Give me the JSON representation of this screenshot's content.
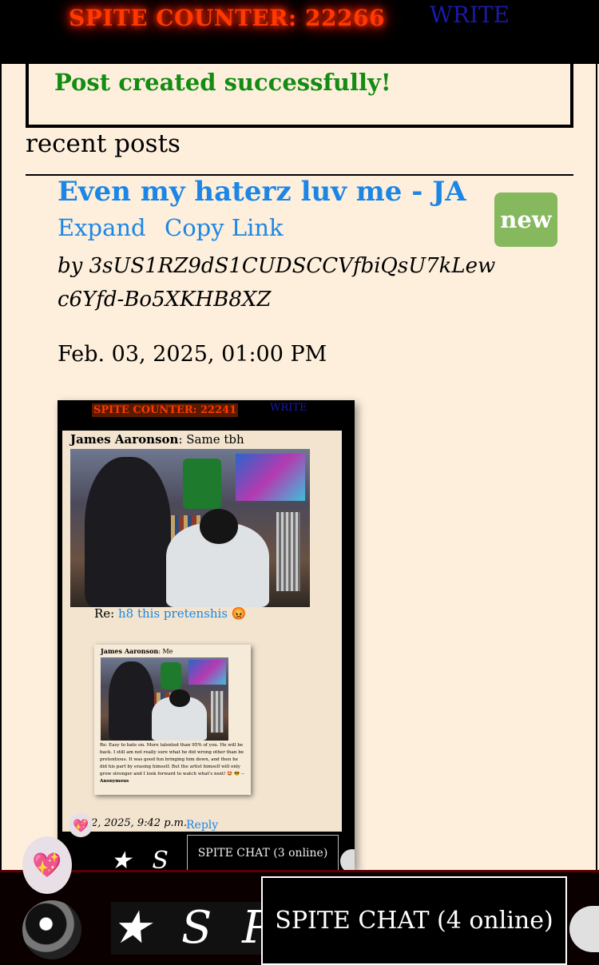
{
  "topbar": {
    "counter_label": "SPITE COUNTER: 22266",
    "write_link": "WRITE"
  },
  "flash": {
    "message": "Post created successfully!"
  },
  "section": {
    "heading": "recent posts"
  },
  "post": {
    "title": "Even my haterz luv me - JA",
    "expand_label": "Expand",
    "copy_link_label": "Copy Link",
    "badge": "new",
    "author": "by 3sUS1RZ9dS1CUDSCCVfbiQsU7kLewc6Yfd-Bo5XKHB8XZ",
    "date": "Feb. 03, 2025, 01:00 PM"
  },
  "embedded_screenshot": {
    "counter_label": "SPITE COUNTER: 22241",
    "write_link": "WRITE",
    "comment_author": "James Aaronson",
    "comment_text": ": Same tbh",
    "reply_prefix": "Re: ",
    "reply_link": "h8 this pretenshis",
    "reply_emoji": "😡",
    "nested": {
      "author": "James Aaronson",
      "text": ": Me",
      "body": "Re: Easy to hate on. More talented than 95% of you. He will be back. I still am not really sure what he did wrong other than be pretentious. It was good fun bringing him down, and then he did his part by erasing himself. But the artist himself will only grow stronger and I look forward to watch what's next! 🤩 😎 -- ",
      "signature": "Anonymous"
    },
    "date_fragment": "2, 2025, 9:42 p.m.",
    "reply_label": "Reply",
    "chat_label": "SPITE CHAT (3 online)",
    "banner_text": "★ S P"
  },
  "footer": {
    "heart_emoji": "💖",
    "banner_text": "★ S P G",
    "chat_label": "SPITE CHAT (4 online)"
  },
  "colors": {
    "counter": "#ff3a00",
    "link": "#1c86e6",
    "success": "#128c12",
    "badge": "#86b85e",
    "background": "#fdefdc"
  }
}
